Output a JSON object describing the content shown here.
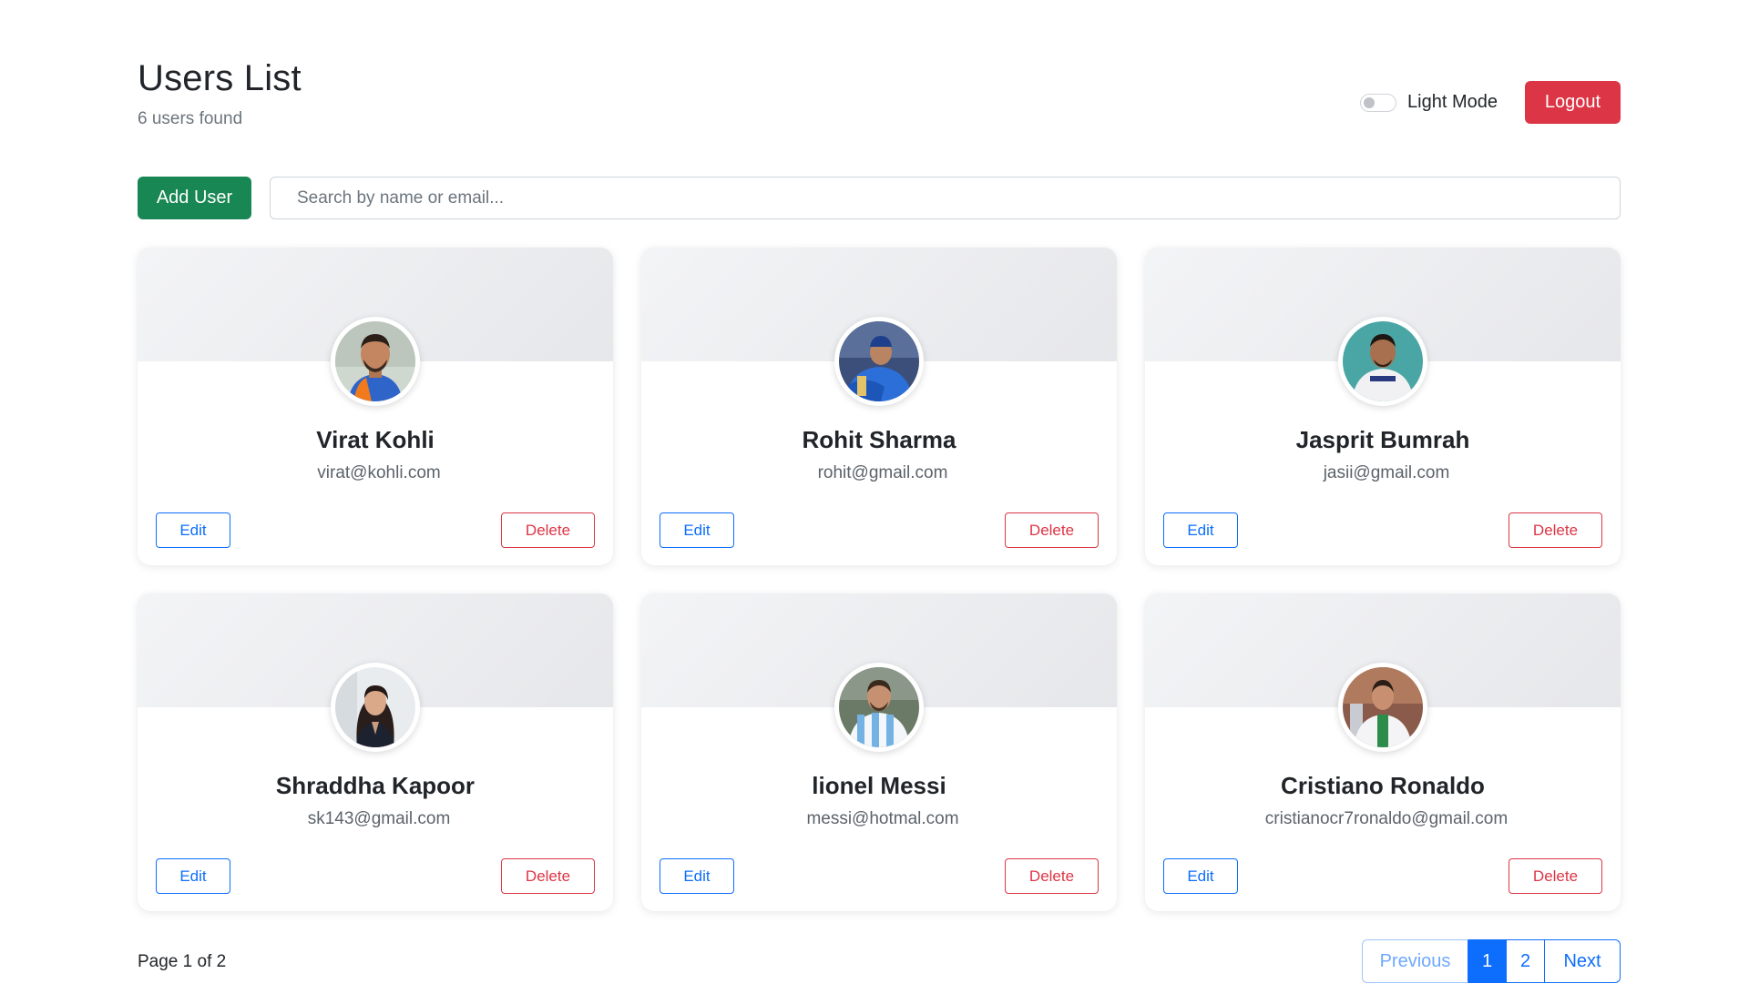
{
  "header": {
    "title": "Users List",
    "subtitle": "6 users found",
    "theme_toggle_label": "Light Mode",
    "logout_label": "Logout"
  },
  "toolbar": {
    "add_user_label": "Add User",
    "search_placeholder": "Search by name or email..."
  },
  "users": [
    {
      "name": "Virat Kohli",
      "email": "virat@kohli.com",
      "edit_label": "Edit",
      "delete_label": "Delete"
    },
    {
      "name": "Rohit Sharma",
      "email": "rohit@gmail.com",
      "edit_label": "Edit",
      "delete_label": "Delete"
    },
    {
      "name": "Jasprit Bumrah",
      "email": "jasii@gmail.com",
      "edit_label": "Edit",
      "delete_label": "Delete"
    },
    {
      "name": "Shraddha Kapoor",
      "email": "sk143@gmail.com",
      "edit_label": "Edit",
      "delete_label": "Delete"
    },
    {
      "name": "lionel Messi",
      "email": "messi@hotmal.com",
      "edit_label": "Edit",
      "delete_label": "Delete"
    },
    {
      "name": "Cristiano Ronaldo",
      "email": "cristianocr7ronaldo@gmail.com",
      "edit_label": "Edit",
      "delete_label": "Delete"
    }
  ],
  "footer": {
    "page_info": "Page 1 of 2",
    "pagination": {
      "previous_label": "Previous",
      "pages": [
        "1",
        "2"
      ],
      "active_page": "1",
      "next_label": "Next"
    }
  },
  "colors": {
    "primary": "#0d6efd",
    "danger": "#dc3545",
    "success": "#198754"
  }
}
